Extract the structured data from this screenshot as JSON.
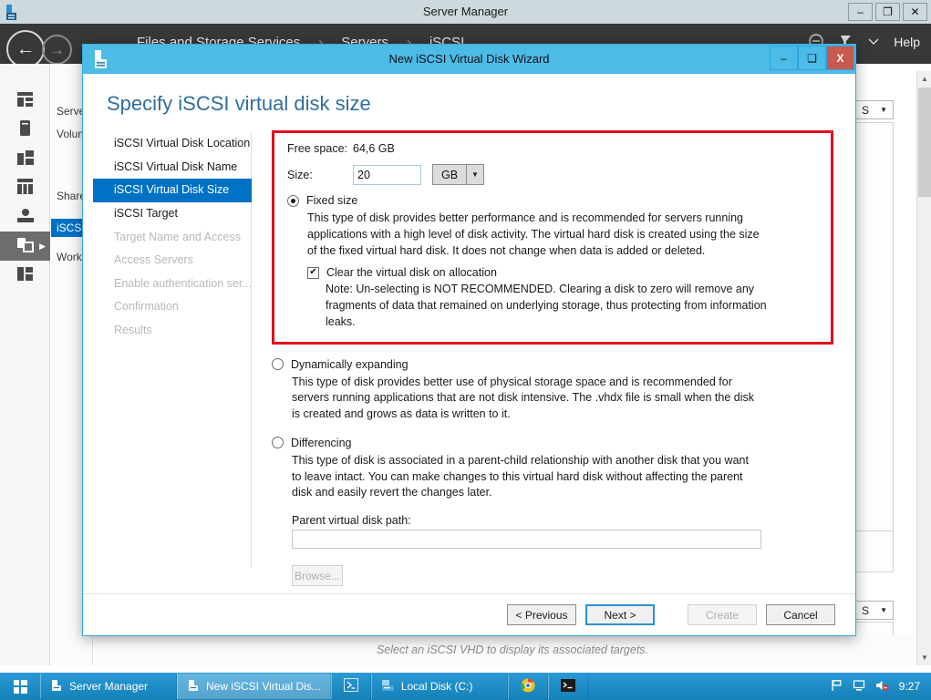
{
  "server_manager": {
    "title": "Server Manager",
    "title_icon": "server-manager-icon",
    "window_buttons": [
      {
        "name": "minimize",
        "glyph": "–"
      },
      {
        "name": "restore",
        "glyph": "❐"
      },
      {
        "name": "close",
        "glyph": "✕"
      }
    ],
    "breadcrumbs": [
      "Files and Storage Services",
      "Servers",
      "iSCSI"
    ],
    "breadcrumb_separator": "›",
    "back_arrow": "←",
    "forward_arrow": "→",
    "help_label": "Help",
    "rail_icons": [
      "dashboard-icon",
      "local-server-icon",
      "all-servers-icon",
      "file-storage-icon",
      "shares-icon",
      "iscsi-icon",
      "work-folders-icon"
    ],
    "nav_items": [
      "Servers",
      "Volumes",
      "Shares",
      "iSCSI",
      "Work Folders"
    ],
    "selected_nav_item": "iSCSI",
    "status_text": "Select an iSCSI VHD to display its associated targets.",
    "filter_combo_label": "S",
    "combo_arrow": "▼"
  },
  "wizard": {
    "title": "New iSCSI Virtual Disk Wizard",
    "title_icon": "wizard-disk-icon",
    "window_buttons": [
      {
        "name": "minimize",
        "glyph": "–"
      },
      {
        "name": "maximize",
        "glyph": "❑"
      },
      {
        "name": "close",
        "glyph": "X"
      }
    ],
    "heading": "Specify iSCSI virtual disk size",
    "steps": [
      {
        "label": "iSCSI Virtual Disk Location",
        "state": "done"
      },
      {
        "label": "iSCSI Virtual Disk Name",
        "state": "done"
      },
      {
        "label": "iSCSI Virtual Disk Size",
        "state": "active"
      },
      {
        "label": "iSCSI Target",
        "state": "done"
      },
      {
        "label": "Target Name and Access",
        "state": "disabled"
      },
      {
        "label": "Access Servers",
        "state": "disabled"
      },
      {
        "label": "Enable authentication ser...",
        "state": "disabled"
      },
      {
        "label": "Confirmation",
        "state": "disabled"
      },
      {
        "label": "Results",
        "state": "disabled"
      }
    ],
    "free_space_label": "Free space:",
    "free_space_value": "64,6 GB",
    "size_label": "Size:",
    "size_value": "20",
    "size_unit": "GB",
    "unit_arrow": "▼",
    "fixed": {
      "label": "Fixed size",
      "selected": true,
      "description": "This type of disk provides better performance and is recommended for servers running applications with a high level of disk activity. The virtual hard disk is created using the size of the fixed virtual hard disk. It does not change when data is added or deleted.",
      "checkbox_label": "Clear the virtual disk on allocation",
      "checkbox_checked": true,
      "check_glyph": "✔",
      "note": "Note: Un-selecting is NOT RECOMMENDED. Clearing a disk to zero will remove any fragments of data that remained on underlying storage, thus protecting from information leaks."
    },
    "dynamic": {
      "label": "Dynamically expanding",
      "selected": false,
      "description": "This type of disk provides better use of physical storage space and is recommended for servers running applications that are not disk intensive. The .vhdx file is small when the disk is created and grows as data is written to it."
    },
    "differencing": {
      "label": "Differencing",
      "selected": false,
      "description": "This type of disk is associated in a parent-child relationship with another disk that you want to leave intact. You can make changes to this virtual hard disk without affecting the parent disk and easily revert the changes later.",
      "parent_path_label": "Parent virtual disk path:",
      "parent_path_value": "",
      "browse_label": "Browse..."
    },
    "buttons": {
      "previous": "< Previous",
      "next": "Next >",
      "create": "Create",
      "cancel": "Cancel"
    },
    "highlight_color": "#e10f1c",
    "accent_color": "#4cbbe8",
    "step_active_color": "#0072c6"
  },
  "taskbar": {
    "start_icon": "windows-start-icon",
    "items": [
      {
        "label": "Server Manager",
        "icon": "server-manager-icon",
        "active": false
      },
      {
        "label": "New iSCSI Virtual Dis...",
        "icon": "wizard-disk-icon",
        "active": true
      },
      {
        "label": "",
        "icon": "powershell-icon",
        "active": false
      },
      {
        "label": "Local Disk (C:)",
        "icon": "explorer-drive-icon",
        "active": false
      },
      {
        "label": "",
        "icon": "chrome-icon",
        "active": false
      },
      {
        "label": "",
        "icon": "cmd-icon",
        "active": false
      }
    ],
    "tray_icons": [
      "flag-icon",
      "network-icon",
      "volume-muted-icon"
    ],
    "clock": "9:27"
  }
}
